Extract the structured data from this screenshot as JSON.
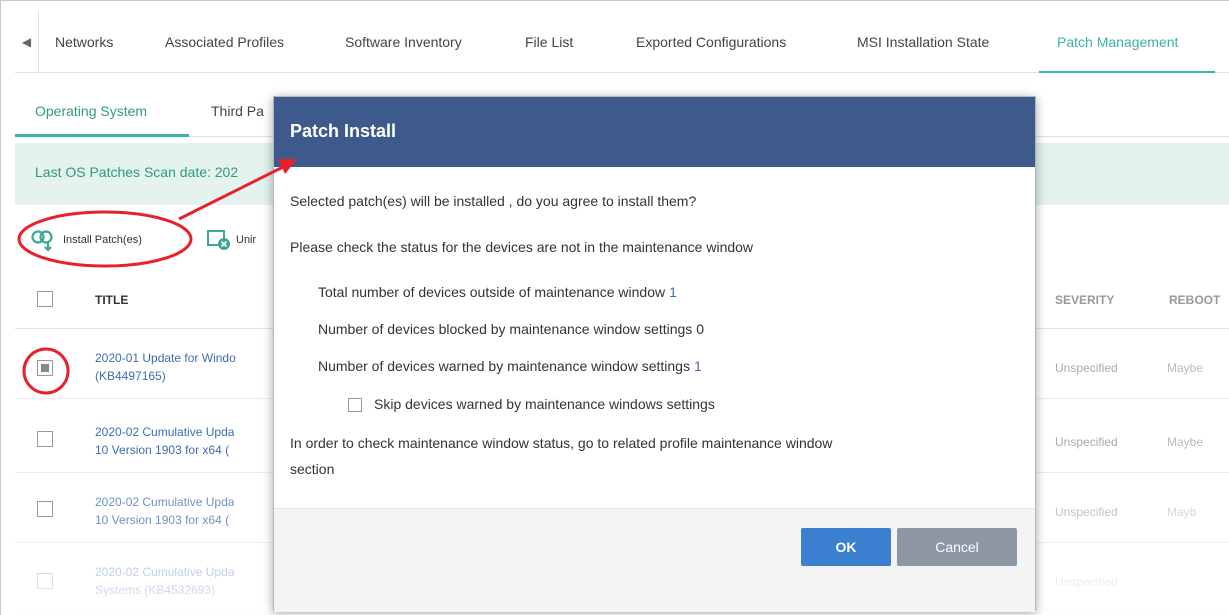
{
  "top_tabs": {
    "items": [
      {
        "label": "Networks"
      },
      {
        "label": "Associated Profiles"
      },
      {
        "label": "Software Inventory"
      },
      {
        "label": "File List"
      },
      {
        "label": "Exported Configurations"
      },
      {
        "label": "MSI Installation State"
      },
      {
        "label": "Patch Management"
      }
    ],
    "active": "Patch Management"
  },
  "sub_tabs": {
    "items": [
      {
        "label": "Operating System"
      },
      {
        "label": "Third Pa"
      }
    ],
    "active": "Operating System"
  },
  "scan_bar": {
    "text": "Last OS Patches Scan date: 202"
  },
  "toolbar": {
    "install_label": "Install Patch(es)",
    "uninstall_label": "Unir"
  },
  "table": {
    "headers": {
      "title": "TITLE",
      "severity": "SEVERITY",
      "reboot": "REBOOT"
    },
    "rows": [
      {
        "title_line1": "2020-01 Update for Windo",
        "title_line2": "(KB4497165)",
        "severity": "Unspecified",
        "reboot": "Maybe",
        "checked": true
      },
      {
        "title_line1": "2020-02 Cumulative Upda",
        "title_line2": "10 Version 1903 for x64 (",
        "severity": "Unspecified",
        "reboot": "Maybe",
        "checked": false
      },
      {
        "title_line1": "2020-02 Cumulative Upda",
        "title_line2": "10 Version 1903 for x64 (",
        "severity": "Unspecified",
        "reboot": "Mayb",
        "checked": false
      },
      {
        "title_line1": "2020-02 Cumulative Upda",
        "title_line2": "Systems (KB4532693)",
        "severity": "Unspecified",
        "reboot": "",
        "checked": false
      }
    ]
  },
  "modal": {
    "title": "Patch Install",
    "question": "Selected patch(es) will be installed , do you agree to install them?",
    "check_status": "Please check the status for the devices are not in the maintenance window",
    "total_outside_label": "Total number of devices outside of maintenance window",
    "total_outside_value": "1",
    "blocked_label": "Number of devices blocked by maintenance window settings",
    "blocked_value": "0",
    "warned_label": "Number of devices warned by maintenance window settings",
    "warned_value": "1",
    "skip_label": "Skip devices warned by maintenance windows settings",
    "order_line1": "In order to check maintenance window status, go to related profile maintenance window",
    "order_line2": "section",
    "ok_label": "OK",
    "cancel_label": "Cancel"
  },
  "colors": {
    "accent": "#3bb3a0",
    "modal_header": "#3e5a8c",
    "link": "#3f6bb4",
    "ok_button": "#3b7fd0",
    "cancel_button": "#8d98a4",
    "annotation": "#e8202a"
  }
}
